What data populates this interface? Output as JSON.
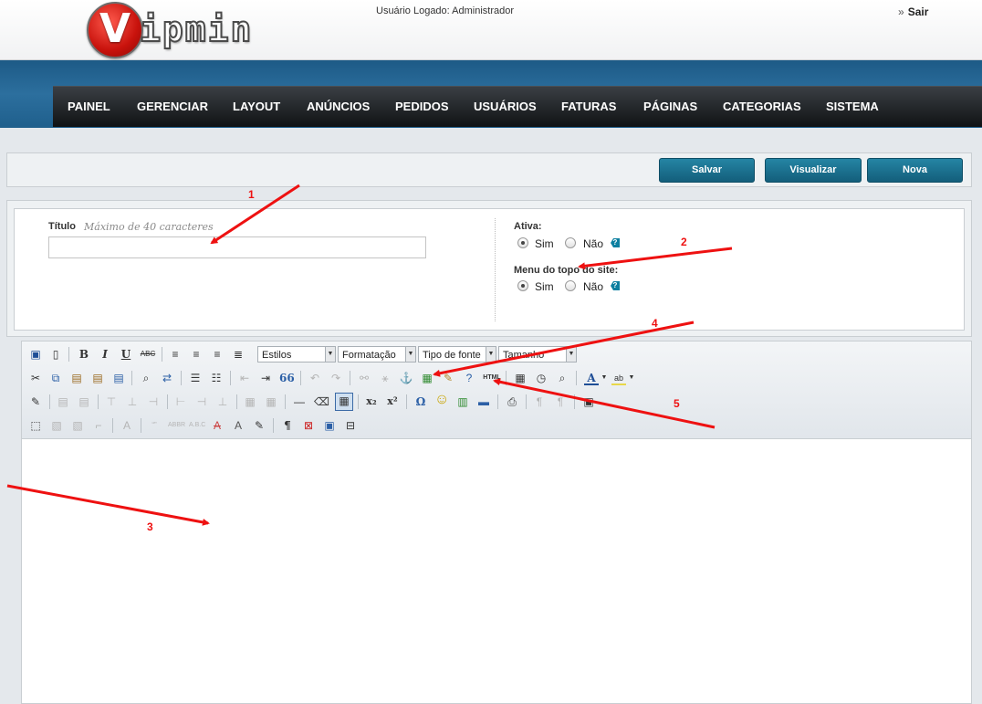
{
  "brand": {
    "logo_letter": "V",
    "logo_text": "ipmin"
  },
  "header": {
    "user_logged": "Usuário Logado: Administrador",
    "logout_chevron": "»",
    "logout_label": "Sair"
  },
  "nav": {
    "items": [
      "PAINEL",
      "GERENCIAR",
      "LAYOUT",
      "ANÚNCIOS",
      "PEDIDOS",
      "USUÁRIOS",
      "FATURAS",
      "PÁGINAS",
      "CATEGORIAS",
      "SISTEMA"
    ]
  },
  "actions": {
    "save": "Salvar",
    "preview": "Visualizar",
    "new": "Nova"
  },
  "form": {
    "title_label": "Título",
    "title_hint": "Máximo de 40 caracteres",
    "title_value": "",
    "active_label": "Ativa:",
    "active_yes": "Sim",
    "active_no": "Não",
    "active_value": "Sim",
    "menu_label": "Menu do topo do site:",
    "menu_yes": "Sim",
    "menu_no": "Não",
    "menu_value": "Sim",
    "help_glyph": "?"
  },
  "editor": {
    "dropdowns": {
      "styles": "Estilos",
      "format": "Formatação",
      "font": "Tipo de fonte",
      "size": "Tamanho"
    },
    "toolbar_icons": [
      "save-icon",
      "new-page-icon",
      "bold-icon",
      "italic-icon",
      "underline-icon",
      "strikethrough-icon",
      "align-left-icon",
      "align-center-icon",
      "align-right-icon",
      "justify-icon",
      "cut-icon",
      "copy-icon",
      "paste-icon",
      "paste-text-icon",
      "paste-word-icon",
      "find-icon",
      "replace-icon",
      "bulleted-list-icon",
      "numbered-list-icon",
      "outdent-icon",
      "indent-icon",
      "blockquote-icon",
      "undo-icon",
      "redo-icon",
      "link-icon",
      "unlink-icon",
      "anchor-icon",
      "image-icon",
      "cleanup-icon",
      "help-icon",
      "html-source-icon",
      "insert-date-icon",
      "insert-time-icon",
      "preview-icon",
      "text-color-icon",
      "highlight-color-icon",
      "edit-icon",
      "table-icon",
      "horizontal-rule-icon",
      "eraser-icon",
      "visual-aid-icon",
      "subscript-icon",
      "superscript-icon",
      "special-char-icon",
      "emoticon-icon",
      "media-icon",
      "separator-icon",
      "print-icon",
      "fullscreen-icon",
      "select-all-icon",
      "abbreviation-icon",
      "acronym-icon",
      "delete-text-icon",
      "attributes-icon",
      "nonbreaking-icon",
      "pagebreak-icon",
      "blocks-icon",
      "template-icon"
    ],
    "labels": {
      "bold": "B",
      "italic": "I",
      "underline": "U",
      "strike": "ABC",
      "quote": "66",
      "html": "HTML",
      "font_color": "A",
      "highlight": "ab",
      "subscript": "x₂",
      "superscript": "x²",
      "omega": "Ω",
      "pilcrow": "¶"
    }
  },
  "annotations": [
    "1",
    "2",
    "3",
    "4",
    "5"
  ],
  "colors": {
    "accent": "#e11111",
    "nav_bg": "#1f5f8c",
    "button": "#135e7b"
  }
}
